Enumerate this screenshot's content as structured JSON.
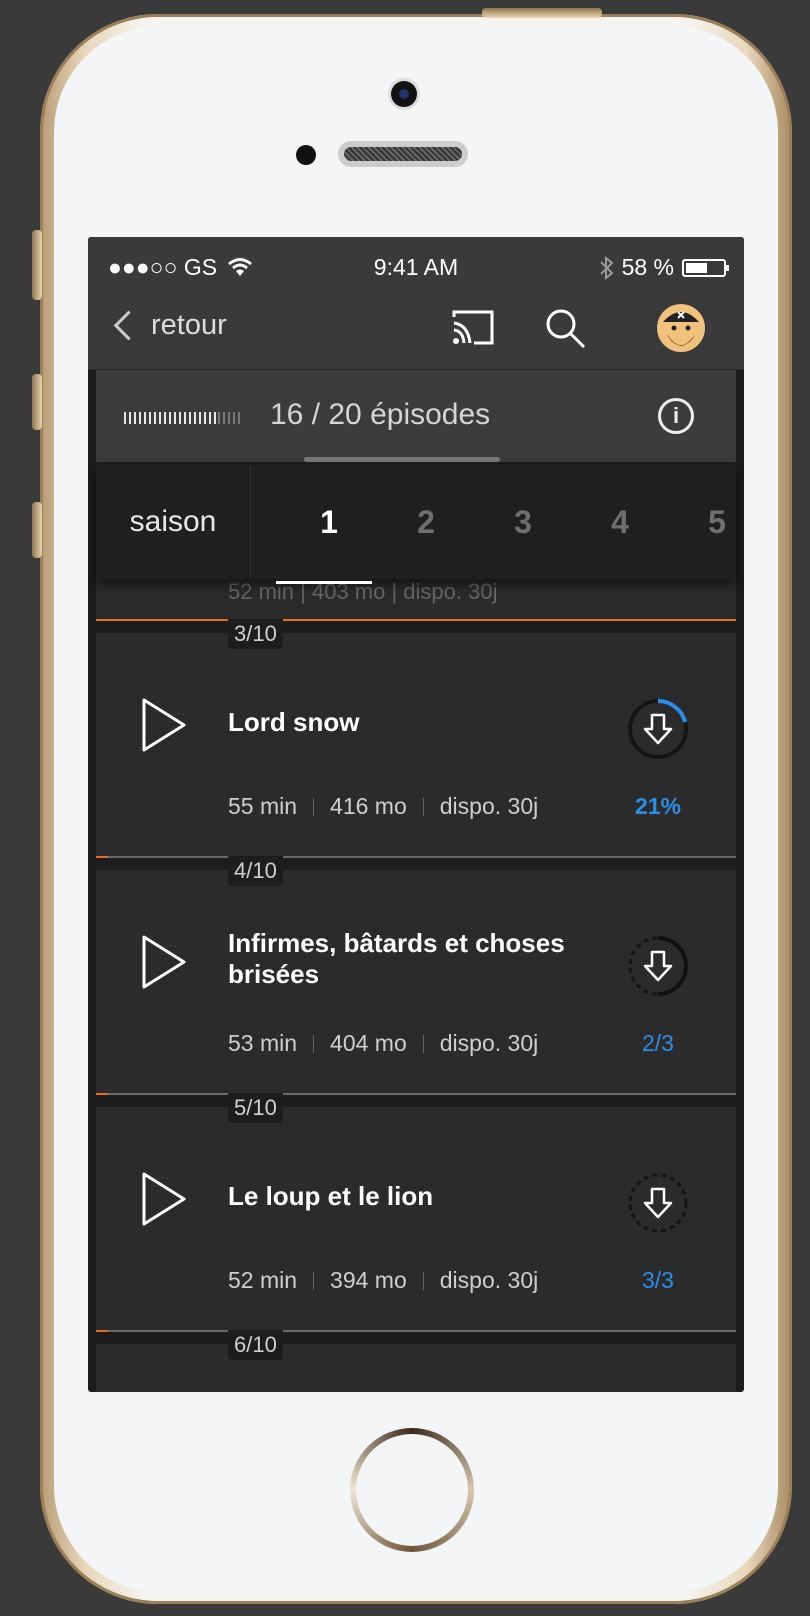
{
  "status_bar": {
    "carrier": "●●●○○ GS",
    "time": "9:41 AM",
    "battery_text": "58 %",
    "battery_level": 0.58
  },
  "nav": {
    "back_label": "retour",
    "icons": [
      "cast-icon",
      "search-icon",
      "avatar"
    ]
  },
  "summary": {
    "episodes_text": "16 / 20 épisodes",
    "watched_fraction": 0.8
  },
  "season": {
    "label": "saison",
    "tabs": [
      "1",
      "2",
      "3",
      "4",
      "5"
    ],
    "active_index": 0
  },
  "previous_episode": {
    "meta_partial": "52 min | 403 mo | dispo. 30j"
  },
  "episodes": [
    {
      "number": "3/10",
      "title": "Lord snow",
      "duration": "55 min",
      "size": "416 mo",
      "availability": "dispo. 30j",
      "download_status": "21%",
      "download_progress": 0.21
    },
    {
      "number": "4/10",
      "title": "Infirmes, bâtards et choses brisées",
      "duration": "53 min",
      "size": "404 mo",
      "availability": "dispo. 30j",
      "download_status": "2/3",
      "download_progress": 0.5
    },
    {
      "number": "5/10",
      "title": "Le loup et le lion",
      "duration": "52 min",
      "size": "394 mo",
      "availability": "dispo. 30j",
      "download_status": "3/3",
      "download_progress": 0
    },
    {
      "number": "6/10"
    }
  ],
  "colors": {
    "accent_blue": "#2a8fe8",
    "accent_orange": "#e07020",
    "background": "#1c1c1c",
    "card": "#2b2b2b"
  }
}
